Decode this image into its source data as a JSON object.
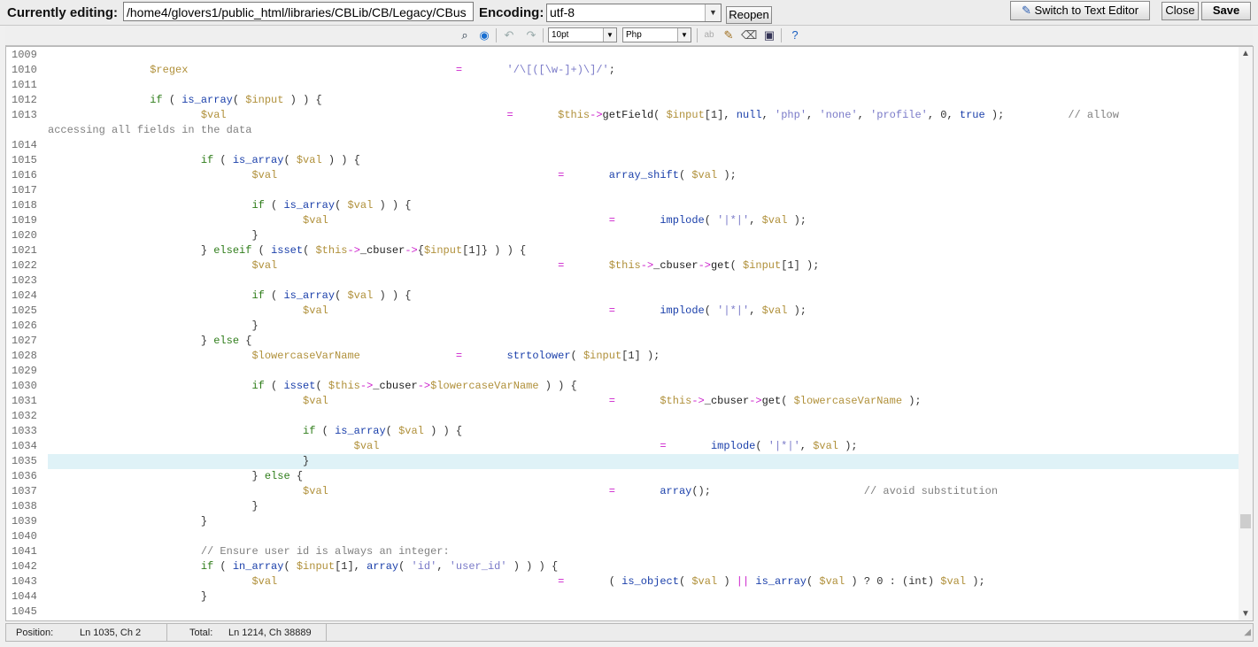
{
  "header": {
    "editing_label": "Currently editing:",
    "path_value": "/home4/glovers1/public_html/libraries/CBLib/CB/Legacy/CBus",
    "encoding_label": "Encoding:",
    "encoding_value": "utf-8",
    "reopen_label": "Reopen",
    "switch_label": "Switch to Text Editor",
    "close_label": "Close",
    "save_label": "Save"
  },
  "toolbar": {
    "font_size": "10pt",
    "syntax": "Php"
  },
  "code_lines": [
    {
      "num": "1009",
      "segs": []
    },
    {
      "num": "1010",
      "segs": [
        [
          "\t\t",
          "p"
        ],
        [
          "$regex",
          "v"
        ],
        [
          "\t\t\t\t\t\t",
          "p"
        ],
        [
          "=",
          "o"
        ],
        [
          "\t",
          "p"
        ],
        [
          "'/\\[([\\w-]+)\\]/'",
          "s"
        ],
        [
          ";",
          "p"
        ]
      ]
    },
    {
      "num": "1011",
      "segs": []
    },
    {
      "num": "1012",
      "segs": [
        [
          "\t\t",
          "p"
        ],
        [
          "if",
          "k"
        ],
        [
          " ( ",
          "p"
        ],
        [
          "is_array",
          "f"
        ],
        [
          "( ",
          "p"
        ],
        [
          "$input",
          "v"
        ],
        [
          " ) ) {",
          "p"
        ]
      ]
    },
    {
      "num": "1013",
      "segs": [
        [
          "\t\t\t",
          "p"
        ],
        [
          "$val",
          "v"
        ],
        [
          "\t\t\t\t\t\t",
          "p"
        ],
        [
          "=",
          "o"
        ],
        [
          "\t",
          "p"
        ],
        [
          "$this",
          "v"
        ],
        [
          "->",
          "o"
        ],
        [
          "getField",
          "m"
        ],
        [
          "( ",
          "p"
        ],
        [
          "$input",
          "v"
        ],
        [
          "[1], ",
          "p"
        ],
        [
          "null",
          "b"
        ],
        [
          ", ",
          "p"
        ],
        [
          "'php'",
          "s"
        ],
        [
          ", ",
          "p"
        ],
        [
          "'none'",
          "s"
        ],
        [
          ", ",
          "p"
        ],
        [
          "'profile'",
          "s"
        ],
        [
          ", 0, ",
          "p"
        ],
        [
          "true",
          "b"
        ],
        [
          " );\t\t",
          "p"
        ],
        [
          "// allow",
          "c"
        ]
      ]
    },
    {
      "num": "",
      "segs": [
        [
          "accessing all fields in the data",
          "c"
        ]
      ]
    },
    {
      "num": "1014",
      "segs": []
    },
    {
      "num": "1015",
      "segs": [
        [
          "\t\t\t",
          "p"
        ],
        [
          "if",
          "k"
        ],
        [
          " ( ",
          "p"
        ],
        [
          "is_array",
          "f"
        ],
        [
          "( ",
          "p"
        ],
        [
          "$val",
          "v"
        ],
        [
          " ) ) {",
          "p"
        ]
      ]
    },
    {
      "num": "1016",
      "segs": [
        [
          "\t\t\t\t",
          "p"
        ],
        [
          "$val",
          "v"
        ],
        [
          "\t\t\t\t\t\t",
          "p"
        ],
        [
          "=",
          "o"
        ],
        [
          "\t",
          "p"
        ],
        [
          "array_shift",
          "f"
        ],
        [
          "( ",
          "p"
        ],
        [
          "$val",
          "v"
        ],
        [
          " );",
          "p"
        ]
      ]
    },
    {
      "num": "1017",
      "segs": []
    },
    {
      "num": "1018",
      "segs": [
        [
          "\t\t\t\t",
          "p"
        ],
        [
          "if",
          "k"
        ],
        [
          " ( ",
          "p"
        ],
        [
          "is_array",
          "f"
        ],
        [
          "( ",
          "p"
        ],
        [
          "$val",
          "v"
        ],
        [
          " ) ) {",
          "p"
        ]
      ]
    },
    {
      "num": "1019",
      "segs": [
        [
          "\t\t\t\t\t",
          "p"
        ],
        [
          "$val",
          "v"
        ],
        [
          "\t\t\t\t\t\t",
          "p"
        ],
        [
          "=",
          "o"
        ],
        [
          "\t",
          "p"
        ],
        [
          "implode",
          "f"
        ],
        [
          "( ",
          "p"
        ],
        [
          "'|*|'",
          "s"
        ],
        [
          ", ",
          "p"
        ],
        [
          "$val",
          "v"
        ],
        [
          " );",
          "p"
        ]
      ]
    },
    {
      "num": "1020",
      "segs": [
        [
          "\t\t\t\t}",
          "p"
        ]
      ]
    },
    {
      "num": "1021",
      "segs": [
        [
          "\t\t\t} ",
          "p"
        ],
        [
          "elseif",
          "k"
        ],
        [
          " ( ",
          "p"
        ],
        [
          "isset",
          "f"
        ],
        [
          "( ",
          "p"
        ],
        [
          "$this",
          "v"
        ],
        [
          "->",
          "o"
        ],
        [
          "_cbuser",
          "m"
        ],
        [
          "->",
          "o"
        ],
        [
          "{",
          "p"
        ],
        [
          "$input",
          "v"
        ],
        [
          "[1]} ) ) {",
          "p"
        ]
      ]
    },
    {
      "num": "1022",
      "segs": [
        [
          "\t\t\t\t",
          "p"
        ],
        [
          "$val",
          "v"
        ],
        [
          "\t\t\t\t\t\t",
          "p"
        ],
        [
          "=",
          "o"
        ],
        [
          "\t",
          "p"
        ],
        [
          "$this",
          "v"
        ],
        [
          "->",
          "o"
        ],
        [
          "_cbuser",
          "m"
        ],
        [
          "->",
          "o"
        ],
        [
          "get",
          "m"
        ],
        [
          "( ",
          "p"
        ],
        [
          "$input",
          "v"
        ],
        [
          "[1] );",
          "p"
        ]
      ]
    },
    {
      "num": "1023",
      "segs": []
    },
    {
      "num": "1024",
      "segs": [
        [
          "\t\t\t\t",
          "p"
        ],
        [
          "if",
          "k"
        ],
        [
          " ( ",
          "p"
        ],
        [
          "is_array",
          "f"
        ],
        [
          "( ",
          "p"
        ],
        [
          "$val",
          "v"
        ],
        [
          " ) ) {",
          "p"
        ]
      ]
    },
    {
      "num": "1025",
      "segs": [
        [
          "\t\t\t\t\t",
          "p"
        ],
        [
          "$val",
          "v"
        ],
        [
          "\t\t\t\t\t\t",
          "p"
        ],
        [
          "=",
          "o"
        ],
        [
          "\t",
          "p"
        ],
        [
          "implode",
          "f"
        ],
        [
          "( ",
          "p"
        ],
        [
          "'|*|'",
          "s"
        ],
        [
          ", ",
          "p"
        ],
        [
          "$val",
          "v"
        ],
        [
          " );",
          "p"
        ]
      ]
    },
    {
      "num": "1026",
      "segs": [
        [
          "\t\t\t\t}",
          "p"
        ]
      ]
    },
    {
      "num": "1027",
      "segs": [
        [
          "\t\t\t} ",
          "p"
        ],
        [
          "else",
          "k"
        ],
        [
          " {",
          "p"
        ]
      ]
    },
    {
      "num": "1028",
      "segs": [
        [
          "\t\t\t\t",
          "p"
        ],
        [
          "$lowercaseVarName",
          "v"
        ],
        [
          "\t\t",
          "p"
        ],
        [
          "=",
          "o"
        ],
        [
          "\t",
          "p"
        ],
        [
          "strtolower",
          "f"
        ],
        [
          "( ",
          "p"
        ],
        [
          "$input",
          "v"
        ],
        [
          "[1] );",
          "p"
        ]
      ]
    },
    {
      "num": "1029",
      "segs": []
    },
    {
      "num": "1030",
      "segs": [
        [
          "\t\t\t\t",
          "p"
        ],
        [
          "if",
          "k"
        ],
        [
          " ( ",
          "p"
        ],
        [
          "isset",
          "f"
        ],
        [
          "( ",
          "p"
        ],
        [
          "$this",
          "v"
        ],
        [
          "->",
          "o"
        ],
        [
          "_cbuser",
          "m"
        ],
        [
          "->",
          "o"
        ],
        [
          "$lowercaseVarName",
          "v"
        ],
        [
          " ) ) {",
          "p"
        ]
      ]
    },
    {
      "num": "1031",
      "segs": [
        [
          "\t\t\t\t\t",
          "p"
        ],
        [
          "$val",
          "v"
        ],
        [
          "\t\t\t\t\t\t",
          "p"
        ],
        [
          "=",
          "o"
        ],
        [
          "\t",
          "p"
        ],
        [
          "$this",
          "v"
        ],
        [
          "->",
          "o"
        ],
        [
          "_cbuser",
          "m"
        ],
        [
          "->",
          "o"
        ],
        [
          "get",
          "m"
        ],
        [
          "( ",
          "p"
        ],
        [
          "$lowercaseVarName",
          "v"
        ],
        [
          " );",
          "p"
        ]
      ]
    },
    {
      "num": "1032",
      "segs": []
    },
    {
      "num": "1033",
      "segs": [
        [
          "\t\t\t\t\t",
          "p"
        ],
        [
          "if",
          "k"
        ],
        [
          " ( ",
          "p"
        ],
        [
          "is_array",
          "f"
        ],
        [
          "( ",
          "p"
        ],
        [
          "$val",
          "v"
        ],
        [
          " ) ) {",
          "p"
        ]
      ]
    },
    {
      "num": "1034",
      "segs": [
        [
          "\t\t\t\t\t\t",
          "p"
        ],
        [
          "$val",
          "v"
        ],
        [
          "\t\t\t\t\t\t",
          "p"
        ],
        [
          "=",
          "o"
        ],
        [
          "\t",
          "p"
        ],
        [
          "implode",
          "f"
        ],
        [
          "( ",
          "p"
        ],
        [
          "'|*|'",
          "s"
        ],
        [
          ", ",
          "p"
        ],
        [
          "$val",
          "v"
        ],
        [
          " );",
          "p"
        ]
      ]
    },
    {
      "num": "1035",
      "segs": [
        [
          "\t\t\t\t\t}",
          "p"
        ]
      ],
      "active": true
    },
    {
      "num": "1036",
      "segs": [
        [
          "\t\t\t\t} ",
          "p"
        ],
        [
          "else",
          "k"
        ],
        [
          " {",
          "p"
        ]
      ]
    },
    {
      "num": "1037",
      "segs": [
        [
          "\t\t\t\t\t",
          "p"
        ],
        [
          "$val",
          "v"
        ],
        [
          "\t\t\t\t\t\t",
          "p"
        ],
        [
          "=",
          "o"
        ],
        [
          "\t",
          "p"
        ],
        [
          "array",
          "f"
        ],
        [
          "();\t\t\t",
          "p"
        ],
        [
          "// avoid substitution",
          "c"
        ]
      ]
    },
    {
      "num": "1038",
      "segs": [
        [
          "\t\t\t\t}",
          "p"
        ]
      ]
    },
    {
      "num": "1039",
      "segs": [
        [
          "\t\t\t}",
          "p"
        ]
      ]
    },
    {
      "num": "1040",
      "segs": []
    },
    {
      "num": "1041",
      "segs": [
        [
          "\t\t\t",
          "p"
        ],
        [
          "// Ensure user id is always an integer:",
          "c"
        ]
      ]
    },
    {
      "num": "1042",
      "segs": [
        [
          "\t\t\t",
          "p"
        ],
        [
          "if",
          "k"
        ],
        [
          " ( ",
          "p"
        ],
        [
          "in_array",
          "f"
        ],
        [
          "( ",
          "p"
        ],
        [
          "$input",
          "v"
        ],
        [
          "[1], ",
          "p"
        ],
        [
          "array",
          "f"
        ],
        [
          "( ",
          "p"
        ],
        [
          "'id'",
          "s"
        ],
        [
          ", ",
          "p"
        ],
        [
          "'user_id'",
          "s"
        ],
        [
          " ) ) ) {",
          "p"
        ]
      ]
    },
    {
      "num": "1043",
      "segs": [
        [
          "\t\t\t\t",
          "p"
        ],
        [
          "$val",
          "v"
        ],
        [
          "\t\t\t\t\t\t",
          "p"
        ],
        [
          "=",
          "o"
        ],
        [
          "\t",
          "p"
        ],
        [
          "( ",
          "p"
        ],
        [
          "is_object",
          "f"
        ],
        [
          "( ",
          "p"
        ],
        [
          "$val",
          "v"
        ],
        [
          " ) ",
          "p"
        ],
        [
          "||",
          "o"
        ],
        [
          " ",
          "p"
        ],
        [
          "is_array",
          "f"
        ],
        [
          "( ",
          "p"
        ],
        [
          "$val",
          "v"
        ],
        [
          " ) ? 0 : (int) ",
          "p"
        ],
        [
          "$val",
          "v"
        ],
        [
          " );",
          "p"
        ]
      ]
    },
    {
      "num": "1044",
      "segs": [
        [
          "\t\t\t}",
          "p"
        ]
      ]
    },
    {
      "num": "1045",
      "segs": []
    }
  ],
  "colors": {
    "k": "#2f7d1a",
    "v": "#b0903a",
    "o": "#cc22cc",
    "s": "#7a7ac8",
    "f": "#1a3faa",
    "m": "#202020",
    "b": "#1a3faa",
    "c": "#808080",
    "p": "#333333"
  },
  "status": {
    "position_label": "Position:",
    "position_value": "Ln 1035, Ch 2",
    "total_label": "Total:",
    "total_value": "Ln 1214, Ch 38889"
  }
}
